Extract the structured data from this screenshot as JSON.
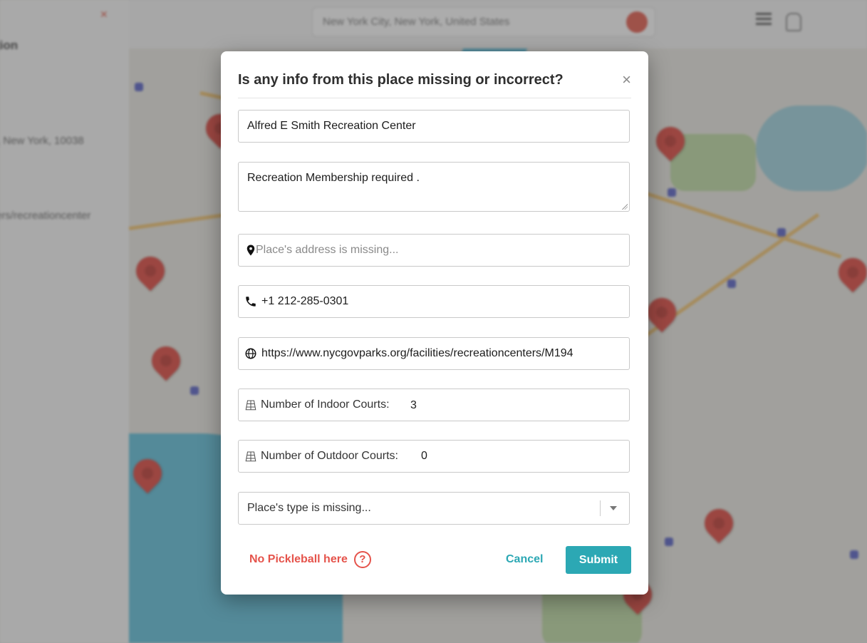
{
  "background": {
    "search_text": "New York City, New York, United States",
    "sidebar_stubs": [
      "tion",
      ", New York, 10038",
      "ers/recreationcenter"
    ]
  },
  "modal": {
    "title": "Is any info from this place missing or incorrect?",
    "close_label": "×",
    "name_value": "Alfred E Smith Recreation Center",
    "description_value": "Recreation Membership required .",
    "address_placeholder": "Place's address is missing...",
    "phone_value": "+1 212-285-0301",
    "website_value": "https://www.nycgovparks.org/facilities/recreationcenters/M194",
    "indoor_label": "Number of Indoor Courts:",
    "indoor_value": "3",
    "outdoor_label": "Number of Outdoor Courts:",
    "outdoor_value": "0",
    "type_placeholder": "Place's type is missing...",
    "no_pickleball_label": "No Pickleball here",
    "help_glyph": "?",
    "cancel_label": "Cancel",
    "submit_label": "Submit"
  },
  "icons": [
    "map-pin-icon",
    "phone-icon",
    "globe-icon",
    "court-icon",
    "chevron-down-icon",
    "help-circle-icon",
    "close-icon"
  ],
  "colors": {
    "accent": "#2ca8b4",
    "danger": "#e5534b",
    "pin": "#e0453d"
  }
}
